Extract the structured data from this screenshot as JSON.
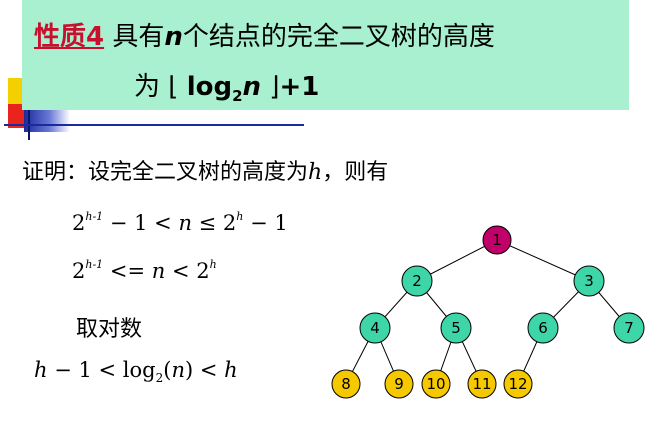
{
  "title": {
    "label": "性质4",
    "text_pre": "具有",
    "n": "n",
    "text_post": "个结点的完全二叉树的高度",
    "line2_prefix": "为",
    "lfloor": "⌊",
    "log": "log",
    "base": "2",
    "rfloor": "⌋",
    "plus_one": "+1"
  },
  "proof": {
    "intro_text": "证明：设完全二叉树的高度为",
    "h": "h",
    "intro_suffix": "，则有"
  },
  "math": {
    "line1": {
      "a": "2",
      "a_exp": "h-1",
      "b": " − 1 < ",
      "n": "n",
      "c": " ≤ 2",
      "c_exp": "h",
      "d": " − 1"
    },
    "line2": {
      "a": "2",
      "a_exp": "h-1",
      "b": " <= ",
      "n": "n",
      "c": " < 2",
      "c_exp": "h"
    },
    "line3": "取对数",
    "line4": {
      "h1": "h",
      "b": " − 1 < log",
      "base": "2",
      "paren_open": "(",
      "n": "n",
      "paren_close": ")",
      "c": " < ",
      "h2": "h"
    }
  },
  "tree": {
    "colors": {
      "root": "#c2006a",
      "inner": "#3ed6a8",
      "leaf": "#f5c800"
    },
    "nodes": [
      {
        "label": "1",
        "kind": "root"
      },
      {
        "label": "2",
        "kind": "inner"
      },
      {
        "label": "3",
        "kind": "inner"
      },
      {
        "label": "4",
        "kind": "inner"
      },
      {
        "label": "5",
        "kind": "inner"
      },
      {
        "label": "6",
        "kind": "inner"
      },
      {
        "label": "7",
        "kind": "inner"
      },
      {
        "label": "8",
        "kind": "leaf"
      },
      {
        "label": "9",
        "kind": "leaf"
      },
      {
        "label": "10",
        "kind": "leaf"
      },
      {
        "label": "11",
        "kind": "leaf"
      },
      {
        "label": "12",
        "kind": "leaf"
      }
    ]
  }
}
